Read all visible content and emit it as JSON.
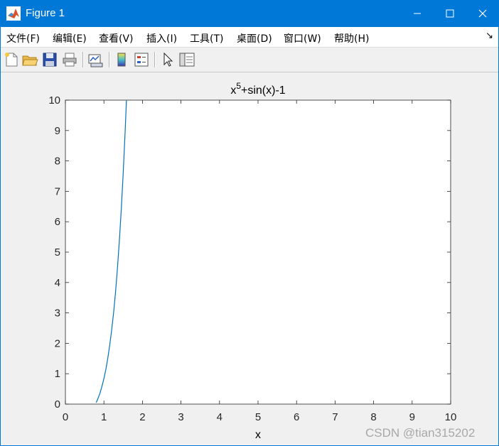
{
  "window": {
    "title": "Figure 1",
    "icon": "matlab-logo-icon",
    "controls": [
      "minimize-icon",
      "maximize-icon",
      "close-icon"
    ]
  },
  "menu": {
    "items": [
      {
        "label": "文件(F)"
      },
      {
        "label": "编辑(E)"
      },
      {
        "label": "查看(V)"
      },
      {
        "label": "插入(I)"
      },
      {
        "label": "工具(T)"
      },
      {
        "label": "桌面(D)"
      },
      {
        "label": "窗口(W)"
      },
      {
        "label": "帮助(H)"
      }
    ],
    "dock_arrow": "↘"
  },
  "toolbar": {
    "icons": [
      "new-figure-icon",
      "open-file-icon",
      "save-icon",
      "print-icon",
      "link-plot-icon",
      "colorbar-icon",
      "legend-icon",
      "pointer-icon",
      "property-editor-icon"
    ]
  },
  "watermark": "CSDN @tian315202",
  "colors": {
    "titlebar": "#0078d7",
    "line": "#0072bd",
    "background": "#f0f0f0"
  },
  "chart_data": {
    "type": "line",
    "title_base": "x",
    "title_sup": "5",
    "title_rest": "+sin(x)-1",
    "xlabel": "x",
    "ylabel": "",
    "xlim": [
      0,
      10
    ],
    "ylim": [
      0,
      10
    ],
    "x_ticks": [
      "0",
      "1",
      "2",
      "3",
      "4",
      "5",
      "6",
      "7",
      "8",
      "9",
      "10"
    ],
    "y_ticks": [
      "0",
      "1",
      "2",
      "3",
      "4",
      "5",
      "6",
      "7",
      "8",
      "9",
      "10"
    ],
    "grid": false,
    "series": [
      {
        "x": [
          0.8,
          0.85,
          0.9,
          0.95,
          1.0,
          1.05,
          1.1,
          1.15,
          1.2,
          1.25,
          1.3,
          1.35,
          1.4,
          1.45,
          1.5,
          1.55,
          1.6
        ],
        "y": [
          0.05,
          0.2,
          0.37,
          0.59,
          0.84,
          1.14,
          1.5,
          1.93,
          2.42,
          3.0,
          3.67,
          4.46,
          5.37,
          6.4,
          7.59,
          8.94,
          10.49
        ]
      }
    ]
  }
}
